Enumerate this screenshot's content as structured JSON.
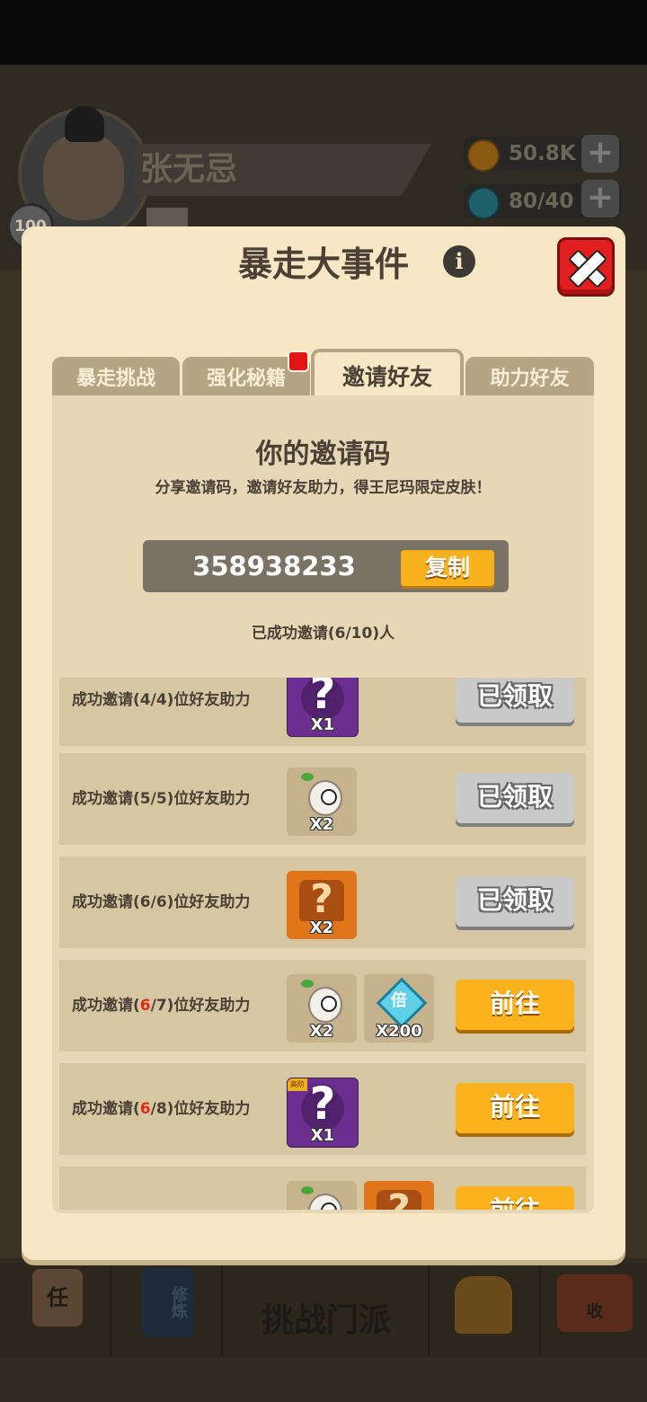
{
  "background": {
    "player_name": "张无忌",
    "level": "100",
    "resource_gold": "50.8K",
    "resource_energy": "80/40",
    "bottom_nav": {
      "task": "任",
      "cultivate": "修炼",
      "challenge": "挑战门派",
      "collect": "收"
    }
  },
  "dialog": {
    "title": "暴走大事件",
    "tabs": [
      "暴走挑战",
      "强化秘籍",
      "邀请好友",
      "助力好友"
    ],
    "active_tab": 2,
    "invite": {
      "title": "你的邀请码",
      "subtitle": "分享邀请码，邀请好友助力，得王尼玛限定皮肤！",
      "code": "358938233",
      "copy_label": "复制",
      "invited_status": "已成功邀请(6/10)人"
    },
    "rows": [
      {
        "prefix": "成功邀请(",
        "current": "4",
        "rest": "/4)位好友助力",
        "rewards": [
          {
            "kind": "purple",
            "count": "X1"
          }
        ],
        "button": "已领取",
        "state": "claimed"
      },
      {
        "prefix": "成功邀请(",
        "current": "5",
        "rest": "/5)位好友助力",
        "rewards": [
          {
            "kind": "bun",
            "count": "X2"
          }
        ],
        "button": "已领取",
        "state": "claimed"
      },
      {
        "prefix": "成功邀请(",
        "current": "6",
        "rest": "/6)位好友助力",
        "rewards": [
          {
            "kind": "shirt",
            "count": "X2"
          }
        ],
        "button": "已领取",
        "state": "claimed"
      },
      {
        "prefix": "成功邀请(",
        "current": "6",
        "rest": "/7)位好友助力",
        "rewards": [
          {
            "kind": "bun",
            "count": "X2"
          },
          {
            "kind": "gem",
            "count": "X200",
            "gem_text": "倍"
          }
        ],
        "button": "前往",
        "state": "go"
      },
      {
        "prefix": "成功邀请(",
        "current": "6",
        "rest": "/8)位好友助力",
        "rewards": [
          {
            "kind": "purple",
            "count": "X1",
            "tag": "高阶"
          }
        ],
        "button": "前往",
        "state": "go"
      },
      {
        "prefix": "",
        "current": "",
        "rest": "",
        "rewards": [
          {
            "kind": "bun",
            "count": ""
          },
          {
            "kind": "shirt",
            "count": ""
          }
        ],
        "button": "前往",
        "state": "go"
      }
    ]
  },
  "colors": {
    "dialog_bg": "#f8e7c4",
    "panel_bg": "#e8d7b6",
    "row_bg": "#d7c6a2",
    "button_go": "#fbb21c",
    "button_claimed": "#c9c9c9",
    "close_red": "#e31e1e",
    "highlight_red": "#e02a1a"
  }
}
